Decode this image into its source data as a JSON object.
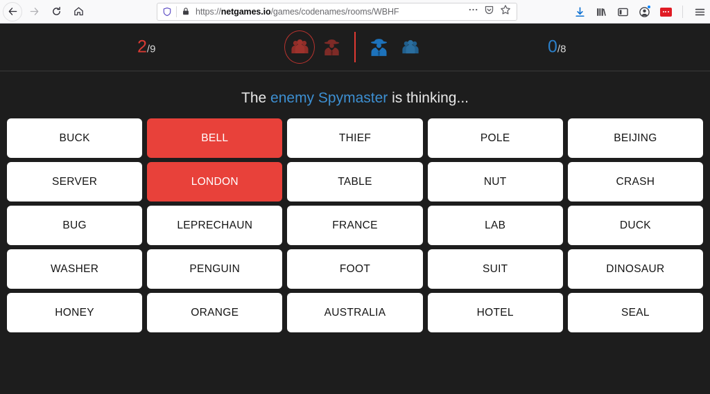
{
  "browser": {
    "nav": {
      "back": "back-arrow",
      "forward": "forward-arrow",
      "reload": "reload-arrow",
      "home": "home-house"
    },
    "url": {
      "protocol": "https://",
      "domain": "netgames.io",
      "path": "/games/codenames/rooms/WBHF",
      "full": "https://netgames.io/games/codenames/rooms/WBHF",
      "shield_icon": "tracking-protection-shield",
      "lock_icon": "padlock-secure",
      "page_actions_icon": "ellipsis-icon",
      "pocket_icon": "pocket-shield-icon",
      "bookmark_icon": "star-bookmark-icon"
    },
    "toolbar": {
      "downloads_icon": "download-arrow-icon",
      "library_icon": "library-books-icon",
      "sidebar_icon": "sidebar-panel-icon",
      "account_icon": "account-avatar-icon",
      "extension_icon": "extension-dots-icon",
      "menu_icon": "hamburger-menu-icon"
    }
  },
  "game": {
    "red_team": {
      "score": "2",
      "separator": "/",
      "total": "9",
      "color": "#d93a33",
      "operatives_icon": "red-operatives-group-icon",
      "spymaster_icon": "red-spymaster-spy-icon",
      "active_role": "operatives"
    },
    "blue_team": {
      "score": "0",
      "separator": "/",
      "total": "8",
      "color": "#2a7fc9",
      "spymaster_icon": "blue-spymaster-spy-icon",
      "operatives_icon": "blue-operatives-group-icon",
      "active_role": "spymaster"
    },
    "turn_divider_color": "#e03a33",
    "prompt": {
      "prefix": "The ",
      "highlight": "enemy Spymaster",
      "suffix": " is thinking...",
      "highlight_color": "#3d8fd1"
    },
    "board": {
      "rows": 5,
      "cols": 5,
      "revealed_red_color": "#e8413a",
      "unrevealed_color": "#ffffff",
      "cards": [
        {
          "word": "BUCK",
          "state": "unrevealed"
        },
        {
          "word": "BELL",
          "state": "red"
        },
        {
          "word": "THIEF",
          "state": "unrevealed"
        },
        {
          "word": "POLE",
          "state": "unrevealed"
        },
        {
          "word": "BEIJING",
          "state": "unrevealed"
        },
        {
          "word": "SERVER",
          "state": "unrevealed"
        },
        {
          "word": "LONDON",
          "state": "red"
        },
        {
          "word": "TABLE",
          "state": "unrevealed"
        },
        {
          "word": "NUT",
          "state": "unrevealed"
        },
        {
          "word": "CRASH",
          "state": "unrevealed"
        },
        {
          "word": "BUG",
          "state": "unrevealed"
        },
        {
          "word": "LEPRECHAUN",
          "state": "unrevealed"
        },
        {
          "word": "FRANCE",
          "state": "unrevealed"
        },
        {
          "word": "LAB",
          "state": "unrevealed"
        },
        {
          "word": "DUCK",
          "state": "unrevealed"
        },
        {
          "word": "WASHER",
          "state": "unrevealed"
        },
        {
          "word": "PENGUIN",
          "state": "unrevealed"
        },
        {
          "word": "FOOT",
          "state": "unrevealed"
        },
        {
          "word": "SUIT",
          "state": "unrevealed"
        },
        {
          "word": "DINOSAUR",
          "state": "unrevealed"
        },
        {
          "word": "HONEY",
          "state": "unrevealed"
        },
        {
          "word": "ORANGE",
          "state": "unrevealed"
        },
        {
          "word": "AUSTRALIA",
          "state": "unrevealed"
        },
        {
          "word": "HOTEL",
          "state": "unrevealed"
        },
        {
          "word": "SEAL",
          "state": "unrevealed"
        }
      ]
    }
  }
}
